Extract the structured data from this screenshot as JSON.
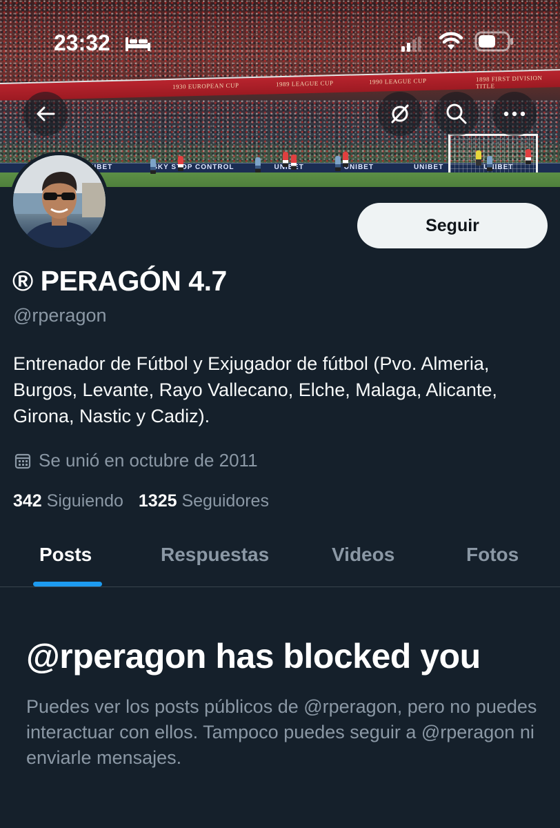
{
  "status_bar": {
    "time": "23:32"
  },
  "banner": {
    "ad_text": "UNIBET",
    "ad_text_2": "SKY STOP CONTROL",
    "stand_sign_1": "1930 EUROPEAN CUP",
    "stand_sign_2": "1989 LEAGUE CUP",
    "stand_sign_3": "1990 LEAGUE CUP",
    "stand_sign_4": "1898 FIRST DIVISION TITLE"
  },
  "nav": {
    "back_icon": "arrow-left-icon",
    "translate_icon": "no-translate-icon",
    "search_icon": "search-icon",
    "more_icon": "more-dots-icon"
  },
  "actions": {
    "follow_label": "Seguir"
  },
  "profile": {
    "display_name": "® PERAGÓN 4.7",
    "handle": "@rperagon",
    "bio": "Entrenador de Fútbol y Exjugador de fútbol (Pvo. Almeria, Burgos, Levante, Rayo Vallecano, Elche, Malaga, Alicante, Girona, Nastic y Cadiz).",
    "joined": "Se unió en octubre de 2011",
    "following_count": "342",
    "following_label": "Siguiendo",
    "followers_count": "1325",
    "followers_label": "Seguidores"
  },
  "tabs": [
    {
      "label": "Posts",
      "active": true
    },
    {
      "label": "Respuestas",
      "active": false
    },
    {
      "label": "Videos",
      "active": false
    },
    {
      "label": "Fotos",
      "active": false
    }
  ],
  "blocked": {
    "title": "@rperagon has blocked you",
    "message": "Puedes ver los posts públicos de @rperagon, pero no puedes interactuar con ellos. Tampoco puedes seguir a @rperagon ni enviarle mensajes."
  },
  "colors": {
    "background": "#15202b",
    "accent": "#1d9bf0",
    "muted_text": "#8b98a5",
    "follow_button_bg": "#eff3f4"
  }
}
